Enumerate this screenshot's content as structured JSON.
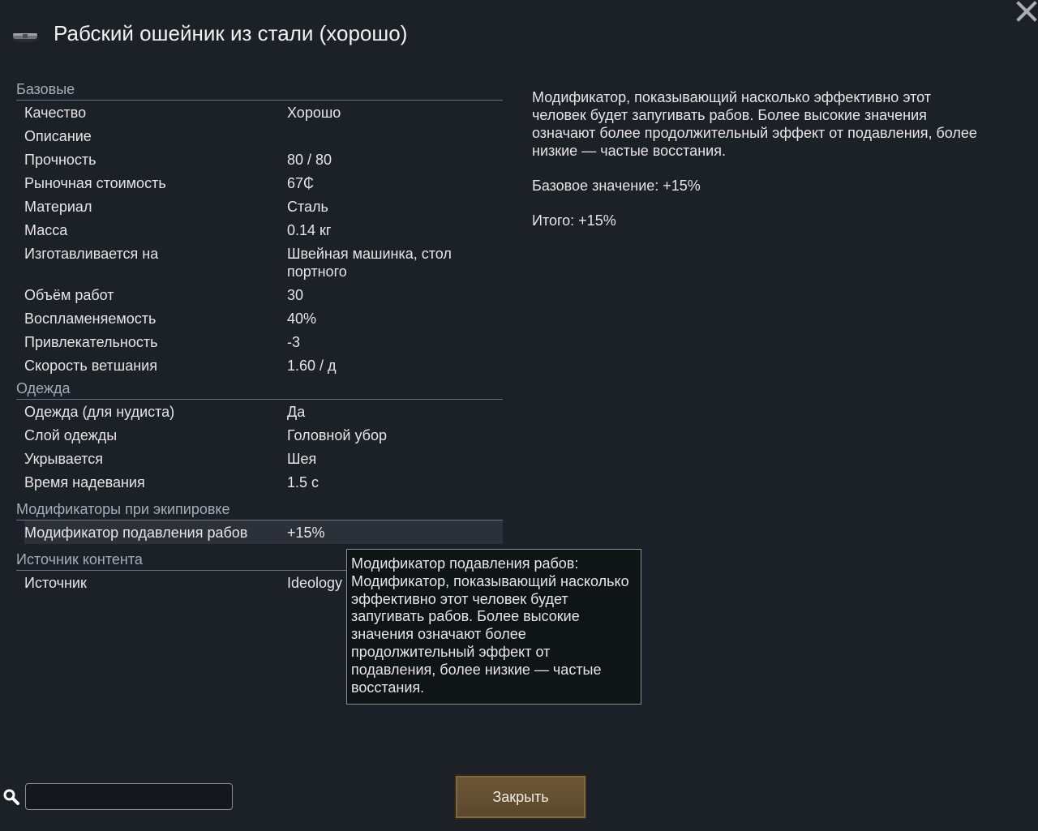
{
  "window": {
    "title": "Рабский ошейник из стали (хорошо)"
  },
  "sections": {
    "base": {
      "header": "Базовые",
      "rows": [
        {
          "label": "Качество",
          "value": "Хорошо"
        },
        {
          "label": "Описание",
          "value": ""
        },
        {
          "label": "Прочность",
          "value": "80 / 80"
        },
        {
          "label": "Рыночная стоимость",
          "value": "67₵"
        },
        {
          "label": "Материал",
          "value": "Сталь"
        },
        {
          "label": "Масса",
          "value": "0.14 кг"
        },
        {
          "label": "Изготавливается на",
          "value": "Швейная машинка, стол портного"
        },
        {
          "label": "Объём работ",
          "value": "30"
        },
        {
          "label": "Воспламеняемость",
          "value": "40%"
        },
        {
          "label": "Привлекательность",
          "value": "-3"
        },
        {
          "label": "Скорость ветшания",
          "value": "1.60 / д"
        }
      ]
    },
    "apparel": {
      "header": "Одежда",
      "rows": [
        {
          "label": "Одежда (для нудиста)",
          "value": "Да"
        },
        {
          "label": "Слой одежды",
          "value": "Головной убор"
        },
        {
          "label": "Укрывается",
          "value": "Шея"
        },
        {
          "label": "Время надевания",
          "value": "1.5 с"
        }
      ]
    },
    "equip": {
      "header": "Модификаторы при экипировке",
      "rows": [
        {
          "label": "Модификатор подавления рабов",
          "value": "+15%"
        }
      ]
    },
    "source": {
      "header": "Источник контента",
      "rows": [
        {
          "label": "Источник",
          "value": "Ideology"
        }
      ]
    }
  },
  "description": {
    "text": "Модификатор, показывающий насколько эффективно этот человек будет запугивать рабов. Более высокие значения означают более продолжительный эффект от подавления, более низкие — частые восстания.",
    "base_value": "Базовое значение: +15%",
    "total": "Итого: +15%"
  },
  "tooltip": {
    "text": "Модификатор подавления рабов: Модификатор, показывающий насколько эффективно этот человек будет запугивать рабов. Более высокие значения означают более продолжительный эффект от подавления, более низкие — частые восстания."
  },
  "search": {
    "value": "",
    "icon": "search-icon"
  },
  "buttons": {
    "close_label": "Закрыть"
  },
  "colors": {
    "background": "#1c2027",
    "button": "#6b5637",
    "tooltip_bg": "#0f1414"
  }
}
